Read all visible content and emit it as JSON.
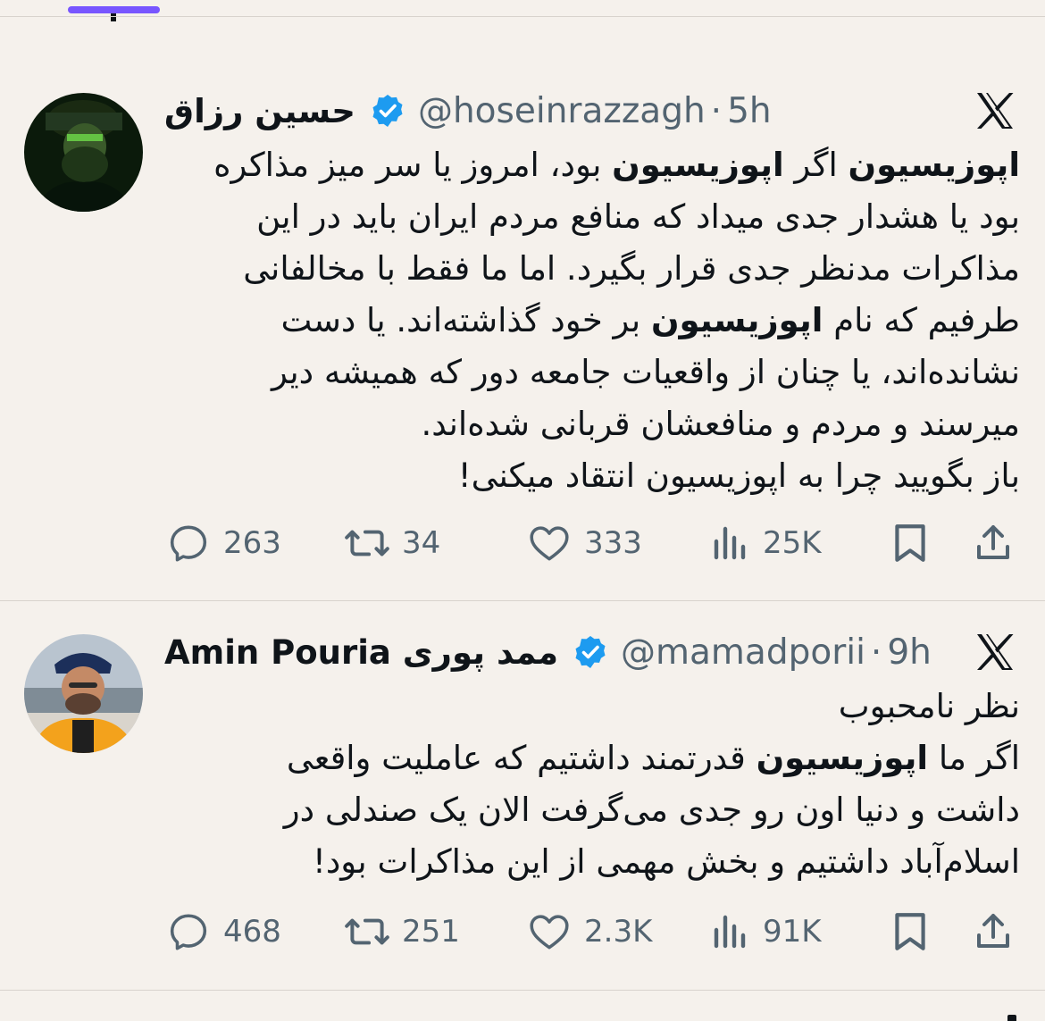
{
  "tweets": [
    {
      "display_name": "حسین رزاق",
      "handle": "@hoseinrazzagh",
      "separator": "·",
      "time": "5h",
      "lines": [
        [
          {
            "t": "اپوزیسیون",
            "b": true
          },
          {
            "t": " اگر "
          },
          {
            "t": "اپوزیسیون",
            "b": true
          },
          {
            "t": " بود، امروز یا سر میز مذاکره"
          }
        ],
        [
          {
            "t": "بود یا هشدار جدی میداد که منافع مردم ایران باید در این"
          }
        ],
        [
          {
            "t": "مذاکرات مدنظر جدی قرار بگیرد. اما ما فقط با مخالفانی"
          }
        ],
        [
          {
            "t": "طرفیم که نام "
          },
          {
            "t": "اپوزیسیون",
            "b": true
          },
          {
            "t": " بر خود گذاشته‌اند. یا دست"
          }
        ],
        [
          {
            "t": "نشانده‌اند، یا چنان از واقعیات جامعه دور که همیشه دیر"
          }
        ],
        [
          {
            "t": "میرسند و مردم و منافعشان قربانی شده‌اند."
          }
        ],
        [
          {
            "t": "باز بگویید چرا به اپوزیسیون انتقاد میکنی!"
          }
        ]
      ],
      "replies": "263",
      "reposts": "34",
      "likes": "333",
      "views": "25K"
    },
    {
      "display_name": "Amin Pouria ممد پوری",
      "handle": "@mamadporii",
      "separator": "·",
      "time": "9h",
      "lines": [
        [
          {
            "t": "نظر نامحبوب"
          }
        ],
        [
          {
            "t": "اگر ما "
          },
          {
            "t": "اپوزیسیون",
            "b": true
          },
          {
            "t": " قدرتمند داشتیم که عاملیت واقعی"
          }
        ],
        [
          {
            "t": "داشت و دنیا اون رو جدی می‌گرفت الان یک صندلی در"
          }
        ],
        [
          {
            "t": "اسلام‌آباد داشتیم و بخش مهمی از این مذاکرات بود!"
          }
        ]
      ],
      "replies": "468",
      "reposts": "251",
      "likes": "2.3K",
      "views": "91K"
    }
  ],
  "icons": {
    "verified": "verified-badge-icon",
    "x_logo": "x-logo-icon",
    "reply": "reply-icon",
    "repost": "repost-icon",
    "like": "heart-icon",
    "views": "views-icon",
    "bookmark": "bookmark-icon",
    "share": "share-icon"
  },
  "colors": {
    "background": "#f5f1ec",
    "text": "#0f1419",
    "muted": "#536471",
    "verified": "#1d9bf0",
    "tab_accent": "#7856ff"
  }
}
